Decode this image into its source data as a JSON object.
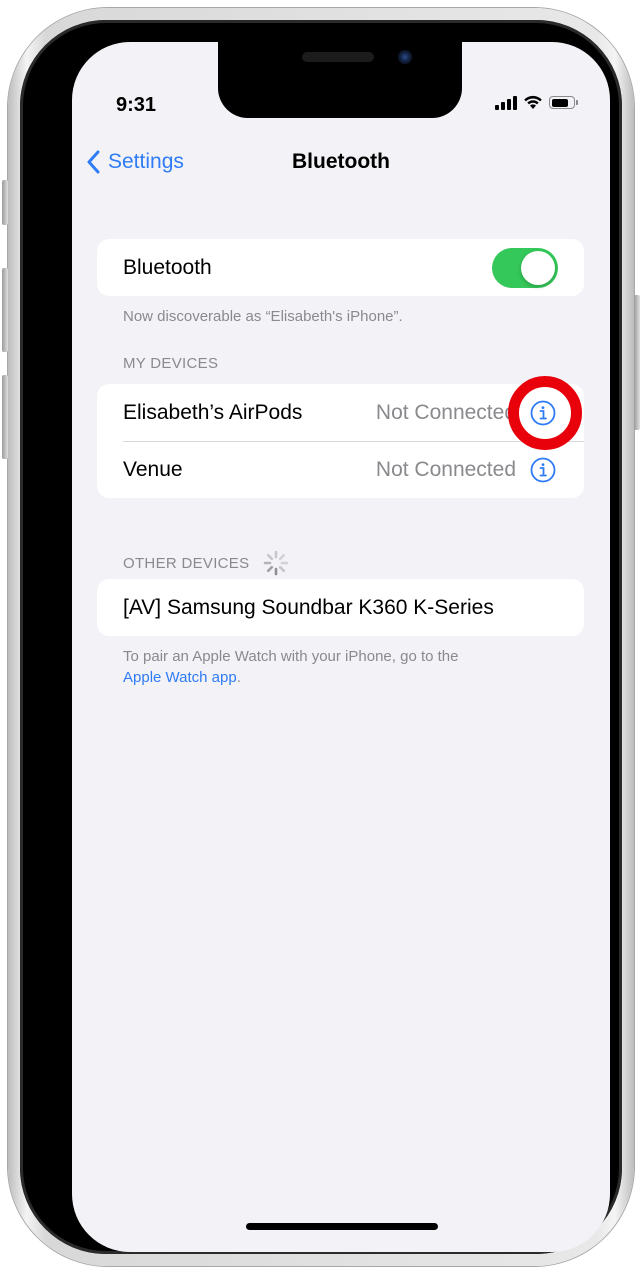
{
  "status_bar": {
    "time": "9:31",
    "icons": [
      "cellular-signal-icon",
      "wifi-icon",
      "battery-icon"
    ],
    "battery_level_fraction": 0.8
  },
  "nav": {
    "back_label": "Settings",
    "back_icon": "chevron-left-icon",
    "title": "Bluetooth"
  },
  "bluetooth_toggle": {
    "label": "Bluetooth",
    "on": true,
    "on_color": "#34c759"
  },
  "discoverable_text": "Now discoverable as “Elisabeth's iPhone”.",
  "my_devices": {
    "header": "MY DEVICES",
    "items": [
      {
        "name": "Elisabeth’s AirPods",
        "status": "Not Connected",
        "info_icon": "info-circle-icon",
        "highlighted": true
      },
      {
        "name": "Venue",
        "status": "Not Connected",
        "info_icon": "info-circle-icon",
        "highlighted": false
      }
    ]
  },
  "other_devices": {
    "header": "OTHER DEVICES",
    "loading_icon": "spinner-icon",
    "items": [
      {
        "name": "[AV] Samsung Soundbar K360 K-Series"
      }
    ]
  },
  "footer": {
    "text": "To pair an Apple Watch with your iPhone, go to the",
    "link_label": "Apple Watch app",
    "suffix": "."
  },
  "colors": {
    "accent": "#2f7cf6",
    "background": "#f2f2f7",
    "secondary_text": "#8a8a8e",
    "annotation_ring": "#e8000b"
  }
}
